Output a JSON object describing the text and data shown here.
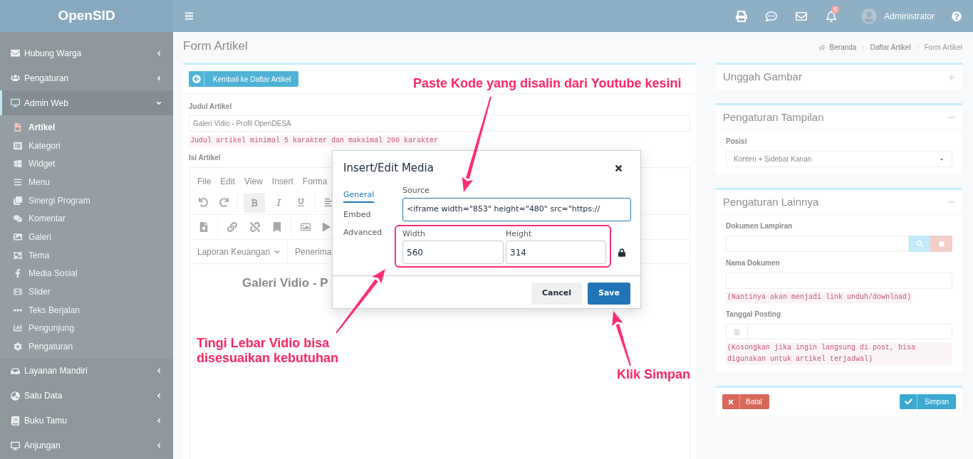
{
  "brand": "OpenSID",
  "topbar": {
    "notifications": "6",
    "user": "Administrator"
  },
  "sidebar": [
    {
      "label": "Hubung Warga",
      "expanded": false
    },
    {
      "label": "Pengaturan",
      "expanded": false
    },
    {
      "label": "Admin Web",
      "expanded": true,
      "children": [
        {
          "label": "Artikel",
          "selected": true
        },
        {
          "label": "Kategori",
          "selected": false
        },
        {
          "label": "Widget",
          "selected": false
        },
        {
          "label": "Menu",
          "selected": false
        },
        {
          "label": "Sinergi Program",
          "selected": false
        },
        {
          "label": "Komentar",
          "selected": false
        },
        {
          "label": "Galeri",
          "selected": false
        },
        {
          "label": "Tema",
          "selected": false
        },
        {
          "label": "Media Sosial",
          "selected": false
        },
        {
          "label": "Slider",
          "selected": false
        },
        {
          "label": "Teks Berjalan",
          "selected": false
        },
        {
          "label": "Pengunjung",
          "selected": false
        },
        {
          "label": "Pengaturan",
          "selected": false
        }
      ]
    },
    {
      "label": "Layanan Mandiri",
      "expanded": false
    },
    {
      "label": "Satu Data",
      "expanded": false
    },
    {
      "label": "Buku Tamu",
      "expanded": false
    },
    {
      "label": "Anjungan",
      "expanded": false
    }
  ],
  "page": {
    "title": "Form Artikel",
    "breadcrumb": [
      "Beranda",
      "Daftar Artikel",
      "Form Artikel"
    ]
  },
  "form": {
    "back_button": "Kembali ke Daftar Artikel",
    "title_label": "Judul Artikel",
    "title_value": "Galeri Vidio - Profil OpenDESA",
    "title_help": "Judul artikel minimal 5 karakter dan maksimal 200 karakter",
    "body_label": "Isi Artikel"
  },
  "editor": {
    "menu": [
      "File",
      "Edit",
      "View",
      "Insert",
      "Forma"
    ],
    "bold_active": true,
    "dropdowns": [
      "Laporan Keuangan",
      "Penerima"
    ],
    "content": "Galeri Vidio - P"
  },
  "side_panels": [
    {
      "title": "Unggah Gambar",
      "expanded": false
    },
    {
      "title": "Pengaturan Tampilan",
      "expanded": true,
      "fields": [
        {
          "kind": "select",
          "label": "Posisi",
          "value": "Konten + Sidebar Kanan"
        }
      ]
    },
    {
      "title": "Pengaturan Lainnya",
      "expanded": true,
      "fields": [
        {
          "kind": "file",
          "label": "Dokumen Lampiran"
        },
        {
          "kind": "text",
          "label": "Nama Dokumen",
          "help": "(Nantinya akan menjadi link unduh/download)"
        },
        {
          "kind": "date",
          "label": "Tanggal Posting",
          "help": "(Kosongkan jika ingin langsung di post, bisa digunakan untuk artikel terjadwal)"
        }
      ]
    }
  ],
  "actions": {
    "cancel": "Batal",
    "save": "Simpan"
  },
  "dialog": {
    "title": "Insert/Edit Media",
    "tabs": [
      {
        "label": "General",
        "selected": true
      },
      {
        "label": "Embed",
        "selected": false
      },
      {
        "label": "Advanced",
        "selected": false
      }
    ],
    "source_label": "Source",
    "source_value": "<iframe width=\"853\" height=\"480\" src=\"https://",
    "width_label": "Width",
    "width_value": "560",
    "height_label": "Height",
    "height_value": "314",
    "constrain_proportions": true,
    "cancel": "Cancel",
    "save": "Save"
  },
  "annotations": [
    {
      "text": "Paste Kode yang disalin dari Youtube kesini"
    },
    {
      "text": "Tingi Lebar Vidio bisa\ndisesuaikan kebutuhan"
    },
    {
      "text": "Klik Simpan"
    }
  ]
}
